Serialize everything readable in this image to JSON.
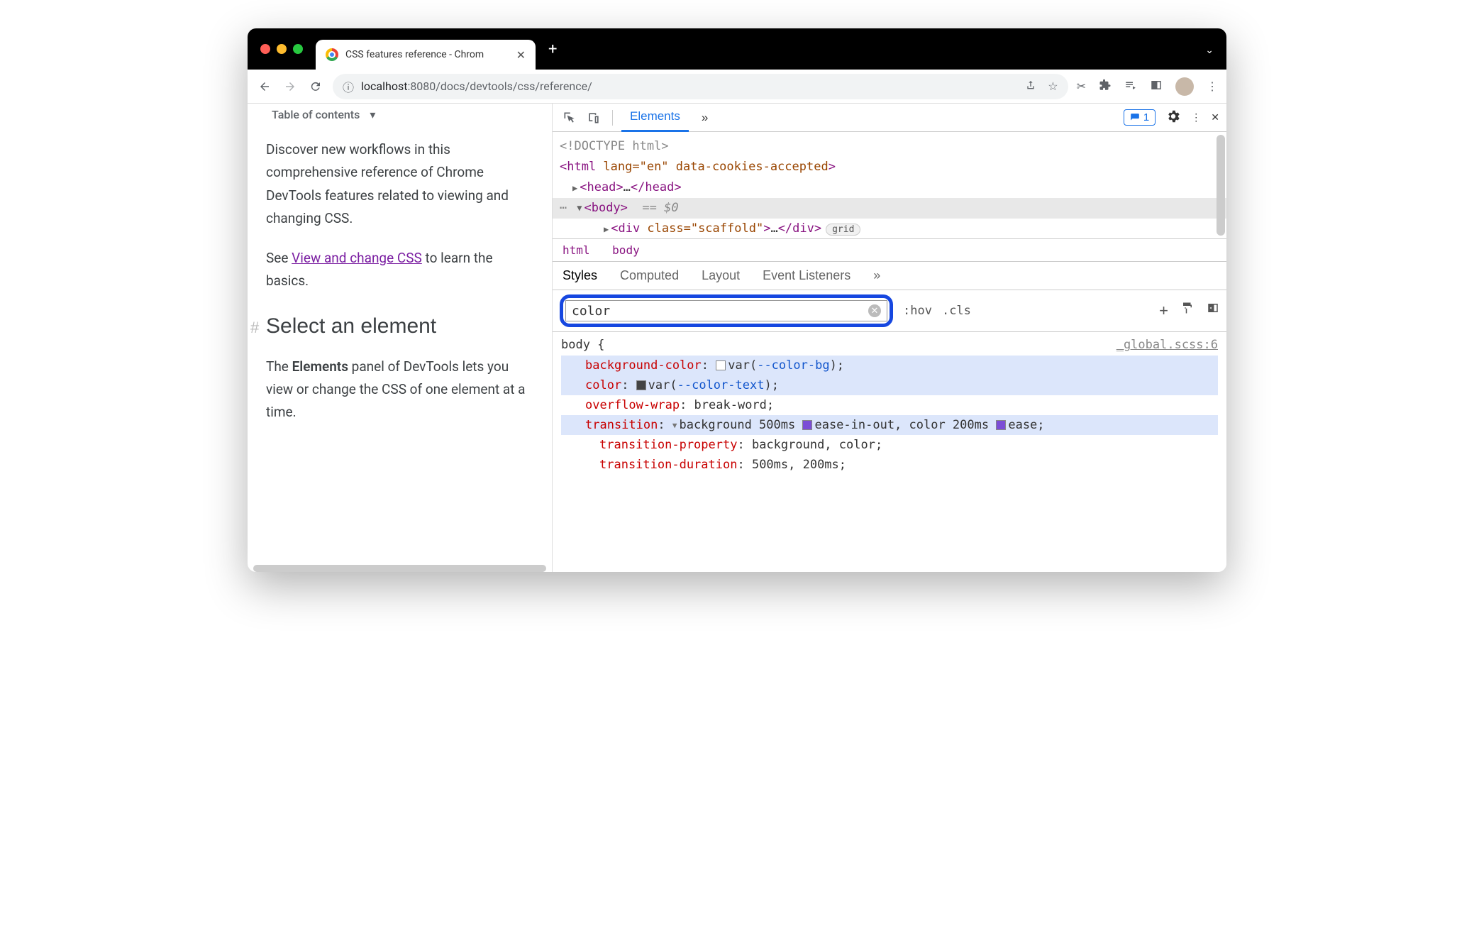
{
  "window": {
    "tab_title": "CSS features reference - Chrom",
    "chevron": "⌄"
  },
  "toolbar": {
    "url_scheme_icon": "ⓘ",
    "url_host": "localhost",
    "url_port": ":8080",
    "url_path": "/docs/devtools/css/reference/"
  },
  "page": {
    "toc": "Table of contents",
    "p1": "Discover new workflows in this comprehensive reference of Chrome DevTools features related to viewing and changing CSS.",
    "p2a": "See ",
    "p2link": "View and change CSS",
    "p2b": " to learn the basics.",
    "h2": "Select an element",
    "p3a": "The ",
    "p3b": "Elements",
    "p3c": " panel of DevTools lets you view or change the CSS of one element at a time."
  },
  "devtools": {
    "main_tab": "Elements",
    "more_tabs": "»",
    "issues_count": "1",
    "dom": {
      "doctype": "<!DOCTYPE html>",
      "html_open": "<html",
      "html_attrs": " lang=\"en\" data-cookies-accepted",
      "html_close": ">",
      "head": "<head>",
      "head_dots": "…",
      "head_end": "</head>",
      "body": "<body>",
      "eq0": "== $0",
      "div": "<div",
      "div_attrs": " class=\"scaffold\"",
      "div_close": ">",
      "div_dots": "…",
      "div_end": "</div>",
      "grid_badge": "grid"
    },
    "crumbs": {
      "a": "html",
      "b": "body"
    },
    "subtabs": {
      "a": "Styles",
      "b": "Computed",
      "c": "Layout",
      "d": "Event Listeners",
      "more": "»"
    },
    "filter": {
      "value": "color",
      "hov": ":hov",
      "cls": ".cls"
    },
    "rule": {
      "selector": "body {",
      "source": "_global.scss:6",
      "d1p": "background-color",
      "d1v1": "var(",
      "d1var": "--color-bg",
      "d1v2": ");",
      "d2p": "color",
      "d2v1": "var(",
      "d2var": "--color-text",
      "d2v2": ");",
      "d3p": "overflow-wrap",
      "d3v": "break-word;",
      "d4p": "transition",
      "d4v1": "background 500ms ",
      "d4v2": "ease-in-out, color 200ms ",
      "d4v3": "ease;",
      "d5p": "transition-property",
      "d5v": "background, color;",
      "d6p": "transition-duration",
      "d6v": "500ms, 200ms;"
    }
  }
}
